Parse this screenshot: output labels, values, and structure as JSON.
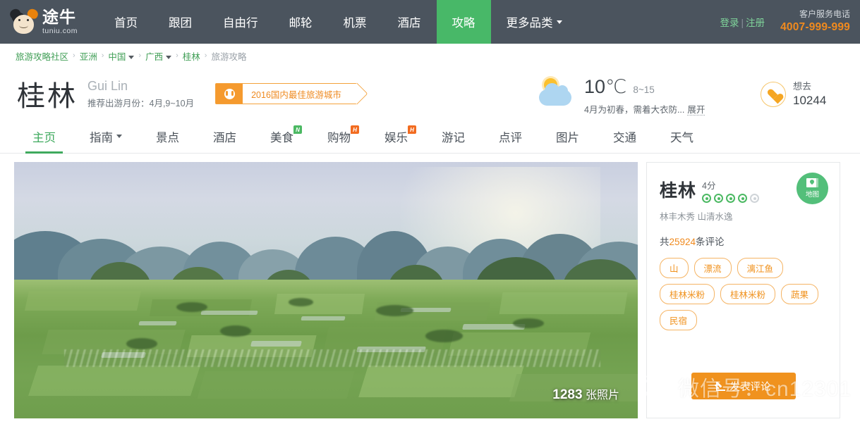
{
  "header": {
    "logo_cn": "途牛",
    "logo_en": "tuniu.com",
    "nav": [
      {
        "label": "首页",
        "active": false,
        "caret": false
      },
      {
        "label": "跟团",
        "active": false,
        "caret": false
      },
      {
        "label": "自由行",
        "active": false,
        "caret": false
      },
      {
        "label": "邮轮",
        "active": false,
        "caret": false
      },
      {
        "label": "机票",
        "active": false,
        "caret": false
      },
      {
        "label": "酒店",
        "active": false,
        "caret": false
      },
      {
        "label": "攻略",
        "active": true,
        "caret": false
      },
      {
        "label": "更多品类",
        "active": false,
        "caret": true
      }
    ],
    "login": "登录",
    "separator": "|",
    "register": "注册",
    "service_label": "客户服务电话",
    "service_phone": "4007-999-999",
    "bg_color": "#4b545e",
    "accent_green": "#48b868",
    "accent_orange": "#f08a1e"
  },
  "breadcrumb": {
    "items": [
      {
        "label": "旅游攻略社区",
        "caret": false,
        "last": false
      },
      {
        "label": "亚洲",
        "caret": false,
        "last": false
      },
      {
        "label": "中国",
        "caret": true,
        "last": false
      },
      {
        "label": "广西",
        "caret": true,
        "last": false
      },
      {
        "label": "桂林",
        "caret": false,
        "last": false
      },
      {
        "label": "旅游攻略",
        "caret": false,
        "last": true
      }
    ],
    "separator": "›"
  },
  "title": {
    "city_cn": "桂林",
    "city_en": "Gui Lin",
    "months": "推荐出游月份：4月,9~10月",
    "award_badge": "2016国内最佳旅游城市"
  },
  "weather": {
    "temp": "10℃",
    "range": "8~15",
    "description": "4月为初春，需着大衣防...",
    "expand": "展开",
    "icon": "sun-cloud-icon"
  },
  "wish": {
    "label": "想去",
    "count": "10244",
    "icon": "heart-icon"
  },
  "tabs": [
    {
      "label": "主页",
      "active": true,
      "caret": false,
      "badge": null
    },
    {
      "label": "指南",
      "active": false,
      "caret": true,
      "badge": null
    },
    {
      "label": "景点",
      "active": false,
      "caret": false,
      "badge": null
    },
    {
      "label": "酒店",
      "active": false,
      "caret": false,
      "badge": null
    },
    {
      "label": "美食",
      "active": false,
      "caret": false,
      "badge": "N"
    },
    {
      "label": "购物",
      "active": false,
      "caret": false,
      "badge": "H"
    },
    {
      "label": "娱乐",
      "active": false,
      "caret": false,
      "badge": "H"
    },
    {
      "label": "游记",
      "active": false,
      "caret": false,
      "badge": null
    },
    {
      "label": "点评",
      "active": false,
      "caret": false,
      "badge": null
    },
    {
      "label": "图片",
      "active": false,
      "caret": false,
      "badge": null
    },
    {
      "label": "交通",
      "active": false,
      "caret": false,
      "badge": null
    },
    {
      "label": "天气",
      "active": false,
      "caret": false,
      "badge": null
    }
  ],
  "hero": {
    "photo_count_number": "1283",
    "photo_count_label": "张照片"
  },
  "panel": {
    "city": "桂林",
    "score": "4分",
    "dots_filled": 4,
    "dots_total": 5,
    "tagline": "林丰木秀 山清水逸",
    "reviews_prefix": "共",
    "reviews_count": "25924",
    "reviews_suffix": "条评论",
    "map_label": "地图",
    "tags": [
      "山",
      "漂流",
      "漓江鱼",
      "桂林米粉",
      "桂林米粉",
      "蔬果",
      "民宿"
    ],
    "comment_button": "发表评论"
  },
  "watermark": {
    "text": "微信号：cn12301",
    "icon": "wechat-icon"
  }
}
